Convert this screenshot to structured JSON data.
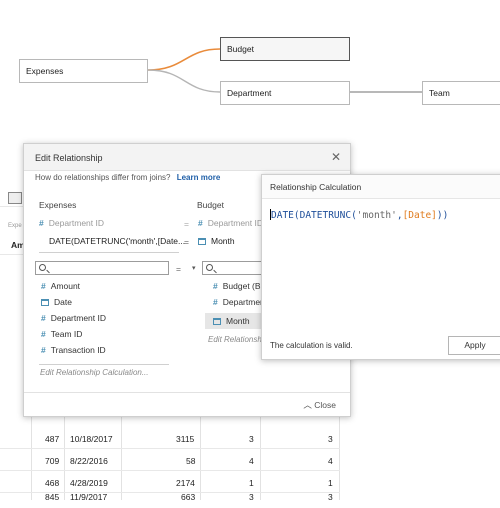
{
  "model": {
    "nodes": {
      "expenses": "Expenses",
      "budget": "Budget",
      "department": "Department",
      "team": "Team"
    },
    "link_color_active": "#e98b3b",
    "link_color": "#b5b5b5"
  },
  "grid": {
    "header_partial_small": "Expe",
    "header_partial": "Am",
    "rows": [
      [
        "487",
        "10/18/2017",
        "3115",
        "3",
        "3"
      ],
      [
        "709",
        "8/22/2016",
        "58",
        "4",
        "4"
      ],
      [
        "468",
        "4/28/2019",
        "2174",
        "1",
        "1"
      ],
      [
        "845",
        "11/9/2017",
        "663",
        "3",
        "3"
      ]
    ]
  },
  "edit_relationship": {
    "title": "Edit Relationship",
    "help_text": "How do relationships differ from joins?",
    "learn_more": "Learn more",
    "left_title": "Expenses",
    "right_title": "Budget",
    "clauses": [
      {
        "left": "Department ID",
        "op": "=",
        "right": "Department ID",
        "active": false
      },
      {
        "left": "DATE(DATETRUNC('month',[Date...",
        "op": "=",
        "right": "Month",
        "active": true
      }
    ],
    "search_op": "=",
    "left_fields": [
      {
        "icon": "number-icon",
        "label": "Amount"
      },
      {
        "icon": "date-icon",
        "label": "Date"
      },
      {
        "icon": "number-icon",
        "label": "Department ID"
      },
      {
        "icon": "number-icon",
        "label": "Team ID"
      },
      {
        "icon": "number-icon",
        "label": "Transaction ID"
      }
    ],
    "right_fields": [
      {
        "icon": "number-icon",
        "label": "Budget (Bu"
      },
      {
        "icon": "number-icon",
        "label": "Departmen"
      },
      {
        "icon": "date-icon",
        "label": "Month"
      }
    ],
    "edit_calc_left": "Edit Relationship Calculation...",
    "edit_calc_right": "Edit Relationshi",
    "close": "Close"
  },
  "relationship_calc": {
    "title": "Relationship Calculation",
    "formula": {
      "fn": "DATE(DATETRUNC(",
      "str": "'month'",
      "comma": ",",
      "ref": "[Date]",
      "end": "))"
    },
    "status": "The calculation is valid.",
    "apply": "Apply"
  }
}
